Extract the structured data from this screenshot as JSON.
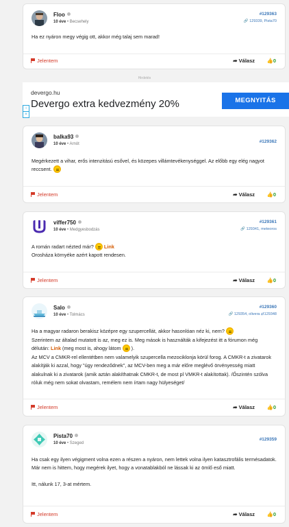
{
  "posts": [
    {
      "username": "Floo",
      "age": "10 éve",
      "location": "Becsehely",
      "post_id": "#129363",
      "refs": "129339, Pista70",
      "refs2": "",
      "lines": [
        "Ha ez nyáron megy végig ott, akkor még talaj sem marad!"
      ]
    },
    {
      "username": "balka93",
      "age": "10 éve",
      "location": "Arnót",
      "post_id": "#129362",
      "refs": "",
      "refs2": "",
      "lines": [
        "Megérkezett a vihar, erős intenzitású esővel, és közepes villámtevékenységgel. Az előbb egy elég nagyot reccsent."
      ]
    },
    {
      "username": "viffer750",
      "age": "10 éve",
      "location": "Medgyesbodzás",
      "post_id": "#129361",
      "refs": "129341, meteoros",
      "refs2": "",
      "lines": [
        "A román radart nézted már?",
        "Link",
        "Orosháza környéke azért kapott rendesen."
      ]
    },
    {
      "username": "Salo",
      "age": "10 éve",
      "location": "Tolmács",
      "post_id": "#129360",
      "refs": "129354, olivera",
      "refs2": "129348",
      "lines": [
        "Ha a magyar radaron berakisz középre egy szupercellát, akkor hasonlóan néz ki, nem?",
        "Szerintem az általad mutatott is az, meg ez is. Meg mások is használták a kifejezést itt a fórumon még délután:",
        "Link",
        "(meg most is, ahogy látom",
        ").",
        "Az MCV a CMKR-rel ellentétben nem valamelyik szupercella mezociklonja körül forog. A CMKR-t a zivatarok alakítják ki azzal, hogy \"úgy rendeződnek\", az MCV-ben meg a már előre meglévő örvényesség miatt alakulnak ki a zivatarok (amik aztán alakíthatnak CMKR-t, de most pl VMKR-t alakítottak). /Őszintén szólva róluk még nem sokat olvastam, remélem nem írtam nagy hülyeséget/"
      ]
    },
    {
      "username": "Pista70",
      "age": "10 éve",
      "location": "Szeged",
      "post_id": "#129359",
      "refs": "",
      "refs2": "",
      "lines": [
        "Ha csak egy ilyen végigment volna ezen a részen a nyáron, nem lettek volna ilyen katasztrofális termésadatok. Már nem is hittem, hogy megérek ilyet, hogy a vonatablakból ne lássak ki az ömlő eső miatt.",
        "Itt, nálunk 17, 3-at mértem."
      ]
    }
  ],
  "footer": {
    "report": "Jelentem",
    "reply": "Válasz",
    "likes": "0"
  },
  "ad": {
    "label": "Hirdetés",
    "domain": "devergo.hu",
    "title": "Devergo extra kedvezmény 20%",
    "button": "MEGNYITÁS",
    "button_color": "#1a73e8"
  },
  "colors": {
    "link": "#d45a00",
    "report": "#d43b2a",
    "like": "#2a9a2a",
    "post_id": "#3a76b8"
  }
}
